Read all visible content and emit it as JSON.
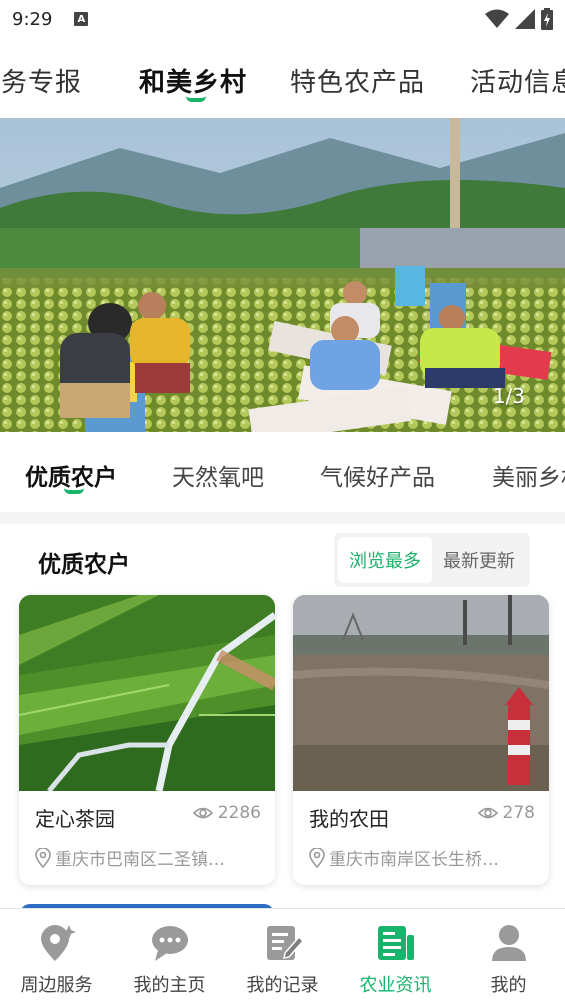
{
  "status": {
    "time": "9:29",
    "a_badge": "A"
  },
  "top_tabs": [
    {
      "label": "服务专报"
    },
    {
      "label": "和美乡村"
    },
    {
      "label": "特色农产品"
    },
    {
      "label": "活动信息"
    }
  ],
  "top_tab_active": "和美乡村",
  "banner": {
    "indicator": "1/3"
  },
  "sub_tabs": [
    {
      "label": "优质农户"
    },
    {
      "label": "天然氧吧"
    },
    {
      "label": "气候好产品"
    },
    {
      "label": "美丽乡村"
    }
  ],
  "section": {
    "title": "优质农户",
    "sort_options": [
      "浏览最多",
      "最新更新"
    ],
    "sort_active": "浏览最多"
  },
  "cards": [
    {
      "title": "定心茶园",
      "views": "2286",
      "location": "重庆市巴南区二圣镇…"
    },
    {
      "title": "我的农田",
      "views": "278",
      "location": "重庆市南岸区长生桥…"
    }
  ],
  "bottom_nav": [
    {
      "label": "周边服务",
      "icon": "location-service-icon"
    },
    {
      "label": "我的主页",
      "icon": "chat-icon"
    },
    {
      "label": "我的记录",
      "icon": "record-edit-icon"
    },
    {
      "label": "农业资讯",
      "icon": "news-icon"
    },
    {
      "label": "我的",
      "icon": "user-icon"
    }
  ],
  "bottom_nav_active": "农业资讯",
  "colors": {
    "accent": "#19b36b",
    "inactive_icon": "#9a9a9a"
  }
}
